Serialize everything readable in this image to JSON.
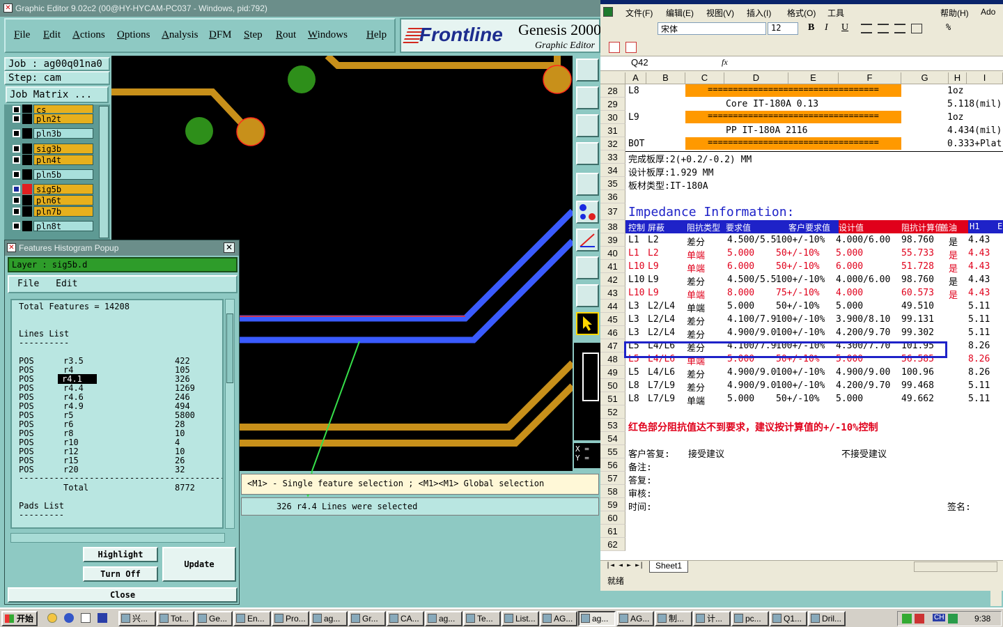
{
  "genesis": {
    "title": "Graphic Editor 9.02c2 (00@HY-HYCAM-PC037 - Windows, pid:792)",
    "menu": [
      "File",
      "Edit",
      "Actions",
      "Options",
      "Analysis",
      "DFM",
      "Step",
      "Rout",
      "Windows",
      "Help"
    ],
    "logo_brand": "Frontline",
    "logo_product": "Genesis 2000",
    "logo_sub": "Graphic Editor",
    "job": "Job : ag00q01na0",
    "step": "Step: cam",
    "job_matrix": "Job Matrix ...",
    "layers": [
      {
        "name": "cs",
        "color": "yellow"
      },
      {
        "name": "pln2t",
        "color": "yellow"
      },
      {
        "name": "pln3b",
        "color": "cyan"
      },
      {
        "name": "sig3b",
        "color": "yellow"
      },
      {
        "name": "pln4t",
        "color": "yellow"
      },
      {
        "name": "pln5b",
        "color": "cyan"
      },
      {
        "name": "sig5b",
        "color": "yellow",
        "active": true
      },
      {
        "name": "pln6t",
        "color": "yellow"
      },
      {
        "name": "pln7b",
        "color": "yellow"
      },
      {
        "name": "pln8t",
        "color": "cyan"
      }
    ],
    "message_hint": "<M1> - Single feature selection ; <M1><M1> Global selection",
    "message_status": "326 r4.4 Lines were selected",
    "coord_x": "X =",
    "coord_y": "Y ="
  },
  "popup": {
    "title": "Features Histogram Popup",
    "layer": "Layer :  sig5b.d",
    "menu_file": "File",
    "menu_edit": "Edit",
    "total_features": "Total Features = 14208",
    "lines_title": "Lines List",
    "rule": "----------",
    "lines": [
      {
        "pol": "POS",
        "sym": "r3.5",
        "count": "422"
      },
      {
        "pol": "POS",
        "sym": "r4",
        "count": "105"
      },
      {
        "pol": "POS",
        "sym": "r4.1",
        "count": "326",
        "selected": true
      },
      {
        "pol": "POS",
        "sym": "r4.4",
        "count": "1269"
      },
      {
        "pol": "POS",
        "sym": "r4.6",
        "count": "246"
      },
      {
        "pol": "POS",
        "sym": "r4.9",
        "count": "494"
      },
      {
        "pol": "POS",
        "sym": "r5",
        "count": "5800"
      },
      {
        "pol": "POS",
        "sym": "r6",
        "count": "28"
      },
      {
        "pol": "POS",
        "sym": "r8",
        "count": "10"
      },
      {
        "pol": "POS",
        "sym": "r10",
        "count": "4"
      },
      {
        "pol": "POS",
        "sym": "r12",
        "count": "10"
      },
      {
        "pol": "POS",
        "sym": "r15",
        "count": "26"
      },
      {
        "pol": "POS",
        "sym": "r20",
        "count": "32"
      }
    ],
    "total_rule": "--------------------------------------------",
    "total_label": "Total",
    "total_value": "8772",
    "pads_title": "Pads List",
    "pads_rule": "---------",
    "btn_highlight": "Highlight",
    "btn_turnoff": "Turn Off",
    "btn_update": "Update",
    "btn_close": "Close"
  },
  "excel": {
    "menu": [
      "文件(F)",
      "编辑(E)",
      "视图(V)",
      "插入(I)",
      "格式(O)",
      "工具",
      "帮助(H)",
      "Ado"
    ],
    "font_name": "宋体",
    "font_size": "12",
    "name_box": "Q42",
    "fx": "fx",
    "columns": [
      "A",
      "B",
      "C",
      "D",
      "E",
      "F",
      "G",
      "H",
      "I"
    ],
    "rows_top": [
      {
        "n": "28",
        "a": "L8",
        "bar": "==================================",
        "h": "1oz"
      },
      {
        "n": "29",
        "mid": "Core      IT-180A    0.13",
        "h": "5.118(mil)"
      },
      {
        "n": "30",
        "a": "L9",
        "bar": "==================================",
        "h": "1oz"
      },
      {
        "n": "31",
        "mid": "PP      IT-180A    2116",
        "h": "4.434(mil)"
      },
      {
        "n": "32",
        "a": "BOT",
        "bar": "==================================",
        "h": "0.333+Plat"
      }
    ],
    "note_rows": [
      {
        "n": "33",
        "text": "完成板厚:2(+0.2/-0.2) MM"
      },
      {
        "n": "34",
        "text": "设计板厚:1.929 MM"
      },
      {
        "n": "35",
        "text": "板材类型:IT-180A"
      },
      {
        "n": "36",
        "text": ""
      }
    ],
    "impedance_title": "Impedance Information:",
    "header_row_num": "38",
    "header": [
      "控制",
      "屏蔽",
      "阻抗类型",
      "要求值",
      "客户要求值",
      "设计值",
      "阻抗计算值",
      "盖油",
      "H1",
      "E"
    ],
    "imp_rows": [
      {
        "n": "39",
        "red": false,
        "c": [
          "L1",
          "L2",
          "差分",
          "4.500/5.50",
          "100+/-10%",
          "4.000/6.00",
          "98.760",
          "是",
          "4.43"
        ]
      },
      {
        "n": "40",
        "red": true,
        "c": [
          "L1",
          "L2",
          "单端",
          "5.000",
          "50+/-10%",
          "5.000",
          "55.733",
          "是",
          "4.43"
        ]
      },
      {
        "n": "41",
        "red": true,
        "c": [
          "L10",
          "L9",
          "单端",
          "6.000",
          "50+/-10%",
          "6.000",
          "51.728",
          "是",
          "4.43"
        ]
      },
      {
        "n": "42",
        "red": false,
        "c": [
          "L10",
          "L9",
          "差分",
          "4.500/5.50",
          "100+/-10%",
          "4.000/6.00",
          "98.760",
          "是",
          "4.43"
        ]
      },
      {
        "n": "43",
        "red": true,
        "c": [
          "L10",
          "L9",
          "单端",
          "8.000",
          "75+/-10%",
          "4.000",
          "60.573",
          "是",
          "4.43"
        ]
      },
      {
        "n": "44",
        "red": false,
        "c": [
          "L3",
          "L2/L4",
          "单端",
          "5.000",
          "50+/-10%",
          "5.000",
          "49.510",
          "",
          "5.11"
        ]
      },
      {
        "n": "45",
        "red": false,
        "c": [
          "L3",
          "L2/L4",
          "差分",
          "4.100/7.90",
          "100+/-10%",
          "3.900/8.10",
          "99.131",
          "",
          "5.11"
        ]
      },
      {
        "n": "46",
        "red": false,
        "c": [
          "L3",
          "L2/L4",
          "差分",
          "4.900/9.00",
          "100+/-10%",
          "4.200/9.70",
          "99.302",
          "",
          "5.11"
        ]
      },
      {
        "n": "47",
        "red": false,
        "c": [
          "L5",
          "L4/L6",
          "差分",
          "4.100/7.90",
          "100+/-10%",
          "4.300/7.70",
          "101.95",
          "",
          "8.26"
        ]
      },
      {
        "n": "48",
        "red": true,
        "c": [
          "L5",
          "L4/L6",
          "单端",
          "5.000",
          "50+/-10%",
          "5.000",
          "56.585",
          "",
          "8.26"
        ]
      },
      {
        "n": "49",
        "red": false,
        "c": [
          "L5",
          "L4/L6",
          "差分",
          "4.900/9.00",
          "100+/-10%",
          "4.900/9.00",
          "100.96",
          "",
          "8.26"
        ]
      },
      {
        "n": "50",
        "red": false,
        "c": [
          "L8",
          "L7/L9",
          "差分",
          "4.900/9.00",
          "100+/-10%",
          "4.200/9.70",
          "99.468",
          "",
          "5.11"
        ]
      },
      {
        "n": "51",
        "red": false,
        "c": [
          "L8",
          "L7/L9",
          "单端",
          "5.000",
          "50+/-10%",
          "5.000",
          "49.662",
          "",
          "5.11"
        ]
      }
    ],
    "row52": "52",
    "warning_row": "53",
    "warning": "红色部分阻抗值达不到要求，建议按计算值的+/-10%控制",
    "footer_rows": [
      {
        "n": "54",
        "a": "",
        "b": "",
        "c": ""
      },
      {
        "n": "55",
        "a": "客户答复:",
        "b": "接受建议",
        "c": "不接受建议"
      },
      {
        "n": "56",
        "a": "备注:",
        "b": "",
        "c": ""
      },
      {
        "n": "57",
        "a": "答复:",
        "b": "",
        "c": ""
      },
      {
        "n": "58",
        "a": "审核:",
        "b": "",
        "c": ""
      },
      {
        "n": "59",
        "a": "时间:",
        "b": "",
        "c": "签名:"
      },
      {
        "n": "60",
        "a": "",
        "b": "",
        "c": ""
      },
      {
        "n": "61",
        "a": "",
        "b": "",
        "c": ""
      },
      {
        "n": "62",
        "a": "",
        "b": "",
        "c": ""
      }
    ],
    "sheet_tab": "Sheet1",
    "status": "就绪"
  },
  "taskbar": {
    "start": "开始",
    "tasks": [
      "兴...",
      "Tot...",
      "Ge...",
      "En...",
      "Pro...",
      "ag...",
      "Gr...",
      "CA...",
      "ag...",
      "Te...",
      "List...",
      "AG...",
      "ag...",
      "AG...",
      "制...",
      "计...",
      "pc...",
      "Q1...",
      "Dril..."
    ],
    "active_task": 12,
    "clock": "9:38",
    "tray_ime": "CH"
  },
  "colors": {
    "copper": "#c8901a",
    "trace_blue": "#3a5bff",
    "pad_green": "#2e8f1a",
    "selection_box": "#1e22c8",
    "annotation_arrow": "#36e04a"
  }
}
